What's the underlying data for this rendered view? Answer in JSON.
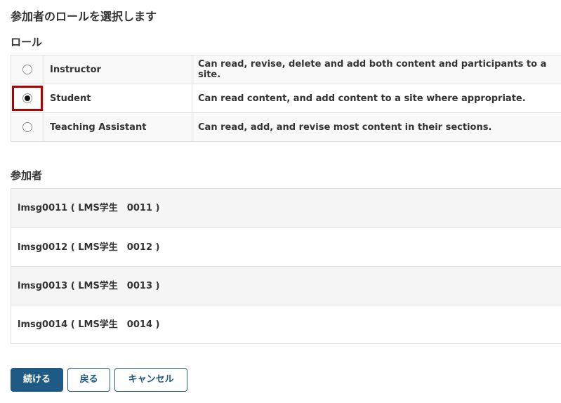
{
  "page_title": "参加者のロールを選択します",
  "roles_heading": "ロール",
  "roles": [
    {
      "name": "Instructor",
      "description": "Can read, revise, delete and add both content and participants to a site.",
      "selected": false
    },
    {
      "name": "Student",
      "description": "Can read content, and add content to a site where appropriate.",
      "selected": true
    },
    {
      "name": "Teaching Assistant",
      "description": "Can read, add, and revise most content in their sections.",
      "selected": false
    }
  ],
  "participants_heading": "参加者",
  "participants": [
    "lmsg0011 ( LMS学生　0011 )",
    "lmsg0012 ( LMS学生　0012 )",
    "lmsg0013 ( LMS学生　0013 )",
    "lmsg0014 ( LMS学生　0014 )"
  ],
  "buttons": {
    "continue": "続ける",
    "back": "戻る",
    "cancel": "キャンセル"
  },
  "colors": {
    "primary": "#1e5a83",
    "highlight": "#b00000"
  }
}
